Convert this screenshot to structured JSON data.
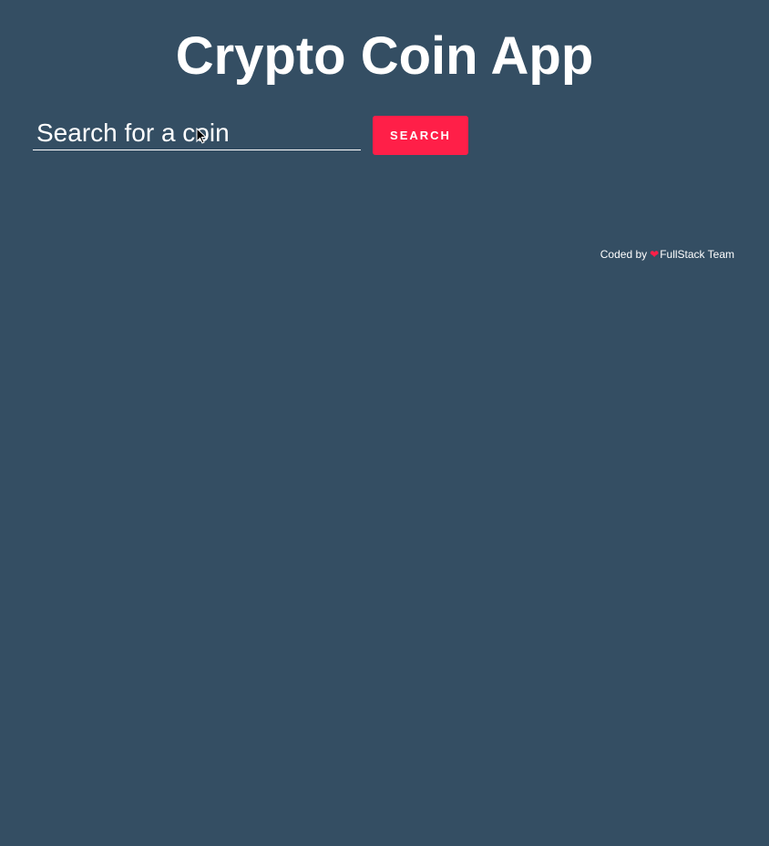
{
  "header": {
    "title": "Crypto Coin App"
  },
  "search": {
    "placeholder": "Search for a coin",
    "value": "",
    "button_label": "SEARCH"
  },
  "footer": {
    "prefix": "Coded by",
    "heart_icon": "heart-icon",
    "author": "FullStack Team"
  },
  "colors": {
    "background": "#344e63",
    "accent": "#ff1f48",
    "text": "#ffffff"
  }
}
